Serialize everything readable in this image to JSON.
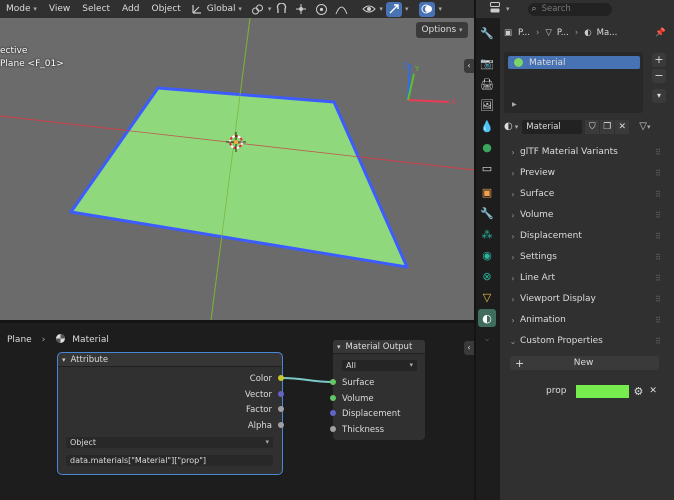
{
  "header": {
    "mode": "Mode",
    "menus": [
      "View",
      "Select",
      "Add",
      "Object"
    ],
    "transform_orientation": "Global",
    "options_label": "Options"
  },
  "viewport": {
    "view_label": "ective",
    "object_label": "Plane <F_01>",
    "gizmo_y": "Y",
    "gizmo_z": "Z",
    "gizmo_x": "X"
  },
  "node_editor": {
    "breadcrumb_object": "Plane",
    "breadcrumb_material": "Material",
    "attribute_node": {
      "title": "Attribute",
      "outputs": [
        "Color",
        "Vector",
        "Factor",
        "Alpha"
      ],
      "type_value": "Object",
      "name_value": "data.materials[\"Material\"][\"prop\"]"
    },
    "output_node": {
      "title": "Material Output",
      "target": "All",
      "inputs": [
        "Surface",
        "Volume",
        "Displacement",
        "Thickness"
      ]
    }
  },
  "properties": {
    "search_placeholder": "Search",
    "breadcrumb": [
      "P...",
      "P...",
      "Ma..."
    ],
    "slot_name": "Material",
    "material_name": "Material",
    "panels": [
      "glTF Material Variants",
      "Preview",
      "Surface",
      "Volume",
      "Displacement",
      "Settings",
      "Line Art",
      "Viewport Display",
      "Animation",
      "Custom Properties"
    ],
    "new_button": "New",
    "prop_name": "prop",
    "prop_color": "#77ec4e"
  },
  "colors": {
    "accent": "#4772b3",
    "plane_fill": "#8fd97c",
    "selection_outline": "#3d5cff",
    "material_green": "#7bd56b"
  }
}
